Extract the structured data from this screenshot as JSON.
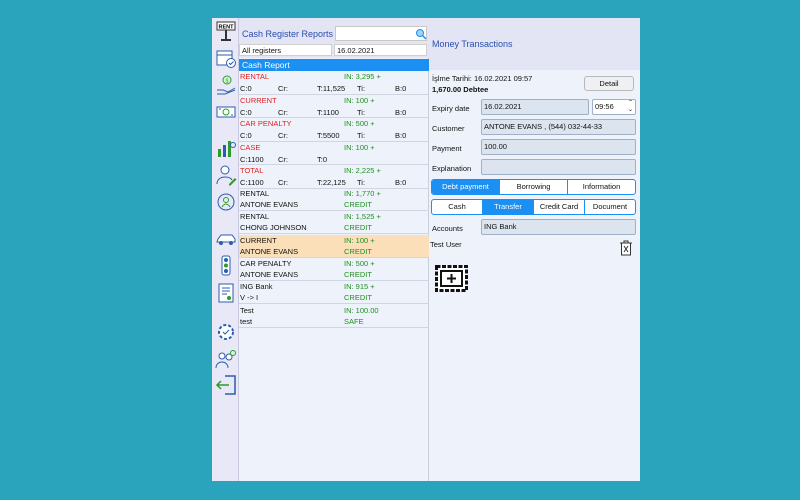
{
  "sidebar": {
    "icons": [
      "rent-sign-icon",
      "calendar-check-icon",
      "cash-hand-icon",
      "banknote-icon",
      "stats-person-icon",
      "person-edit-icon",
      "person-refresh-icon",
      "car-icon",
      "traffic-light-icon",
      "invoice-icon",
      "settings-check-icon",
      "users-add-icon",
      "logout-icon"
    ]
  },
  "list": {
    "title": "Cash Register Reports",
    "search": {
      "value": ""
    },
    "register_filter": "All registers",
    "date_filter": "16.02.2021",
    "section_label": "Cash Report",
    "report_rows": [
      {
        "name": "RENTAL",
        "in": "IN: 3,295 +",
        "c": "C:0",
        "cr": "Cr:",
        "t": "T:11,525",
        "ti": "Ti:",
        "b": "B:0"
      },
      {
        "name": "CURRENT",
        "in": "IN: 100 +",
        "c": "C:0",
        "cr": "Cr:",
        "t": "T:1100",
        "ti": "Ti:",
        "b": "B:0"
      },
      {
        "name": "CAR PENALTY",
        "in": "IN: 500 +",
        "c": "C:0",
        "cr": "Cr:",
        "t": "T:5500",
        "ti": "Ti:",
        "b": "B:0"
      },
      {
        "name": "CASE",
        "in": "IN: 100 +",
        "c": "C:1100",
        "cr": "Cr:",
        "t": "T:0",
        "ti": "",
        "b": ""
      },
      {
        "name": "TOTAL",
        "in": "IN: 2,225 +",
        "c": "C:1100",
        "cr": "Cr:",
        "t": "T:22,125",
        "ti": "Ti:",
        "b": "B:0"
      }
    ],
    "transactions": [
      {
        "type": "RENTAL",
        "who": "ANTONE EVANS",
        "in": "IN: 1,770 +",
        "kind": "CREDIT"
      },
      {
        "type": "RENTAL",
        "who": "CHONG JOHNSON",
        "in": "IN: 1,525 +",
        "kind": "CREDIT"
      },
      {
        "type": "CURRENT",
        "who": "ANTONE EVANS",
        "in": "IN: 100 +",
        "kind": "CREDIT"
      },
      {
        "type": "CAR PENALTY",
        "who": "ANTONE EVANS",
        "in": "IN: 500 +",
        "kind": "CREDIT"
      },
      {
        "type": "ING Bank",
        "who": "V -> I",
        "in": "IN: 915 +",
        "kind": "CREDIT"
      },
      {
        "type": "Test",
        "who": "test",
        "in": "IN: 100.00",
        "kind": "SAFE"
      }
    ],
    "selected_index": 2,
    "add_icon": "plus-circle-icon"
  },
  "detail": {
    "title": "Money Transactions",
    "date_line": "İşlme Tarihi: 16.02.2021 09:57",
    "amount_line": "1,670.00 Debtee",
    "detail_button": "Detail",
    "expiry_label": "Expiry date",
    "expiry_date": "16.02.2021",
    "expiry_time": "09:56",
    "customer_label": "Customer",
    "customer_value": "ANTONE EVANS ,  (544) 032-44-33",
    "payment_label": "Payment",
    "payment_value": "100.00",
    "explanation_label": "Explanation",
    "explanation_value": "",
    "type_tabs": [
      "Debt payment",
      "Borrowing",
      "Information"
    ],
    "type_selected": 0,
    "method_tabs": [
      "Cash",
      "Transfer",
      "Credit Card",
      "Document"
    ],
    "method_selected": 1,
    "accounts_label": "Accounts",
    "accounts_value": "ING Bank",
    "user_label": "Test User",
    "trash_icon": "trash-icon",
    "image_add_icon": "add-image-icon"
  },
  "colors": {
    "accent": "#1b8ff2",
    "highlight": "#fbdfb9",
    "credit": "#1f8f1f",
    "report_name": "#e02020"
  }
}
